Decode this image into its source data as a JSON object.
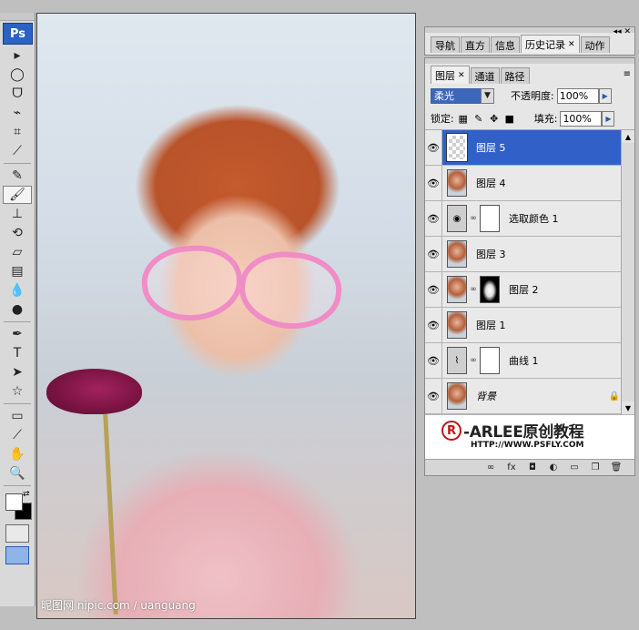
{
  "app": {
    "logo": "Ps"
  },
  "toolbox": {
    "tools": [
      {
        "name": "move-tool-icon",
        "glyph": "▸"
      },
      {
        "name": "elliptical-marquee-icon",
        "glyph": "◯"
      },
      {
        "name": "lasso-icon",
        "glyph": "ᗜ"
      },
      {
        "name": "quick-select-icon",
        "glyph": "⌁"
      },
      {
        "name": "crop-icon",
        "glyph": "⌗"
      },
      {
        "name": "eyedropper-icon",
        "glyph": "⟋"
      },
      {
        "name": "healing-brush-icon",
        "glyph": "✎"
      },
      {
        "name": "brush-icon",
        "glyph": "🖌"
      },
      {
        "name": "clone-stamp-icon",
        "glyph": "⊥"
      },
      {
        "name": "history-brush-icon",
        "glyph": "⟲"
      },
      {
        "name": "eraser-icon",
        "glyph": "▱"
      },
      {
        "name": "gradient-icon",
        "glyph": "▤"
      },
      {
        "name": "blur-icon",
        "glyph": "💧"
      },
      {
        "name": "dodge-icon",
        "glyph": "●"
      },
      {
        "name": "pen-icon",
        "glyph": "✒"
      },
      {
        "name": "type-icon",
        "glyph": "T"
      },
      {
        "name": "path-select-icon",
        "glyph": "➤"
      },
      {
        "name": "shape-icon",
        "glyph": "☆"
      },
      {
        "name": "notes-icon",
        "glyph": "▭"
      },
      {
        "name": "eyedropper2-icon",
        "glyph": "⟋"
      },
      {
        "name": "hand-icon",
        "glyph": "✋"
      },
      {
        "name": "zoom-icon",
        "glyph": "🔍"
      }
    ],
    "active_tool": "brush-icon",
    "swap_glyph": "⇄"
  },
  "canvas": {
    "watermark": "昵图网 nipic.com / uanguang"
  },
  "panel_top": {
    "tabs": [
      {
        "label": "导航"
      },
      {
        "label": "直方"
      },
      {
        "label": "信息"
      },
      {
        "label": "历史记录",
        "active": true,
        "close": "✕"
      },
      {
        "label": "动作"
      }
    ],
    "controls": "◂◂ ✕"
  },
  "layers_panel": {
    "tabs": [
      {
        "label": "图层",
        "active": true,
        "close": "✕"
      },
      {
        "label": "通道"
      },
      {
        "label": "路径"
      }
    ],
    "menu_glyph": "≡",
    "blend_mode": "柔光",
    "opacity_label": "不透明度:",
    "opacity_value": "100%",
    "lock_label": "锁定:",
    "fill_label": "填充:",
    "fill_value": "100%",
    "layers": [
      {
        "name": "图层 5",
        "thumb": "transparent",
        "selected": true
      },
      {
        "name": "图层 4",
        "thumb": "photo"
      },
      {
        "name": "选取颜色 1",
        "thumb": "adjust",
        "adjust_glyph": "◉",
        "mask": "white"
      },
      {
        "name": "图层 3",
        "thumb": "photo"
      },
      {
        "name": "图层 2",
        "thumb": "photo",
        "mask": "bw"
      },
      {
        "name": "图层 1",
        "thumb": "photo"
      },
      {
        "name": "曲线 1",
        "thumb": "adjust",
        "adjust_glyph": "⌇",
        "mask": "white"
      },
      {
        "name": "背景",
        "thumb": "photo",
        "italic": true,
        "locked": true
      }
    ],
    "logo": {
      "mark": "R",
      "text": "-ARLEE原创教程",
      "url": "HTTP://WWW.PSFLY.COM"
    },
    "footer_icons": [
      "link-icon",
      "fx-icon",
      "mask-icon",
      "adjustment-icon",
      "group-icon",
      "new-layer-icon",
      "trash-icon"
    ]
  }
}
